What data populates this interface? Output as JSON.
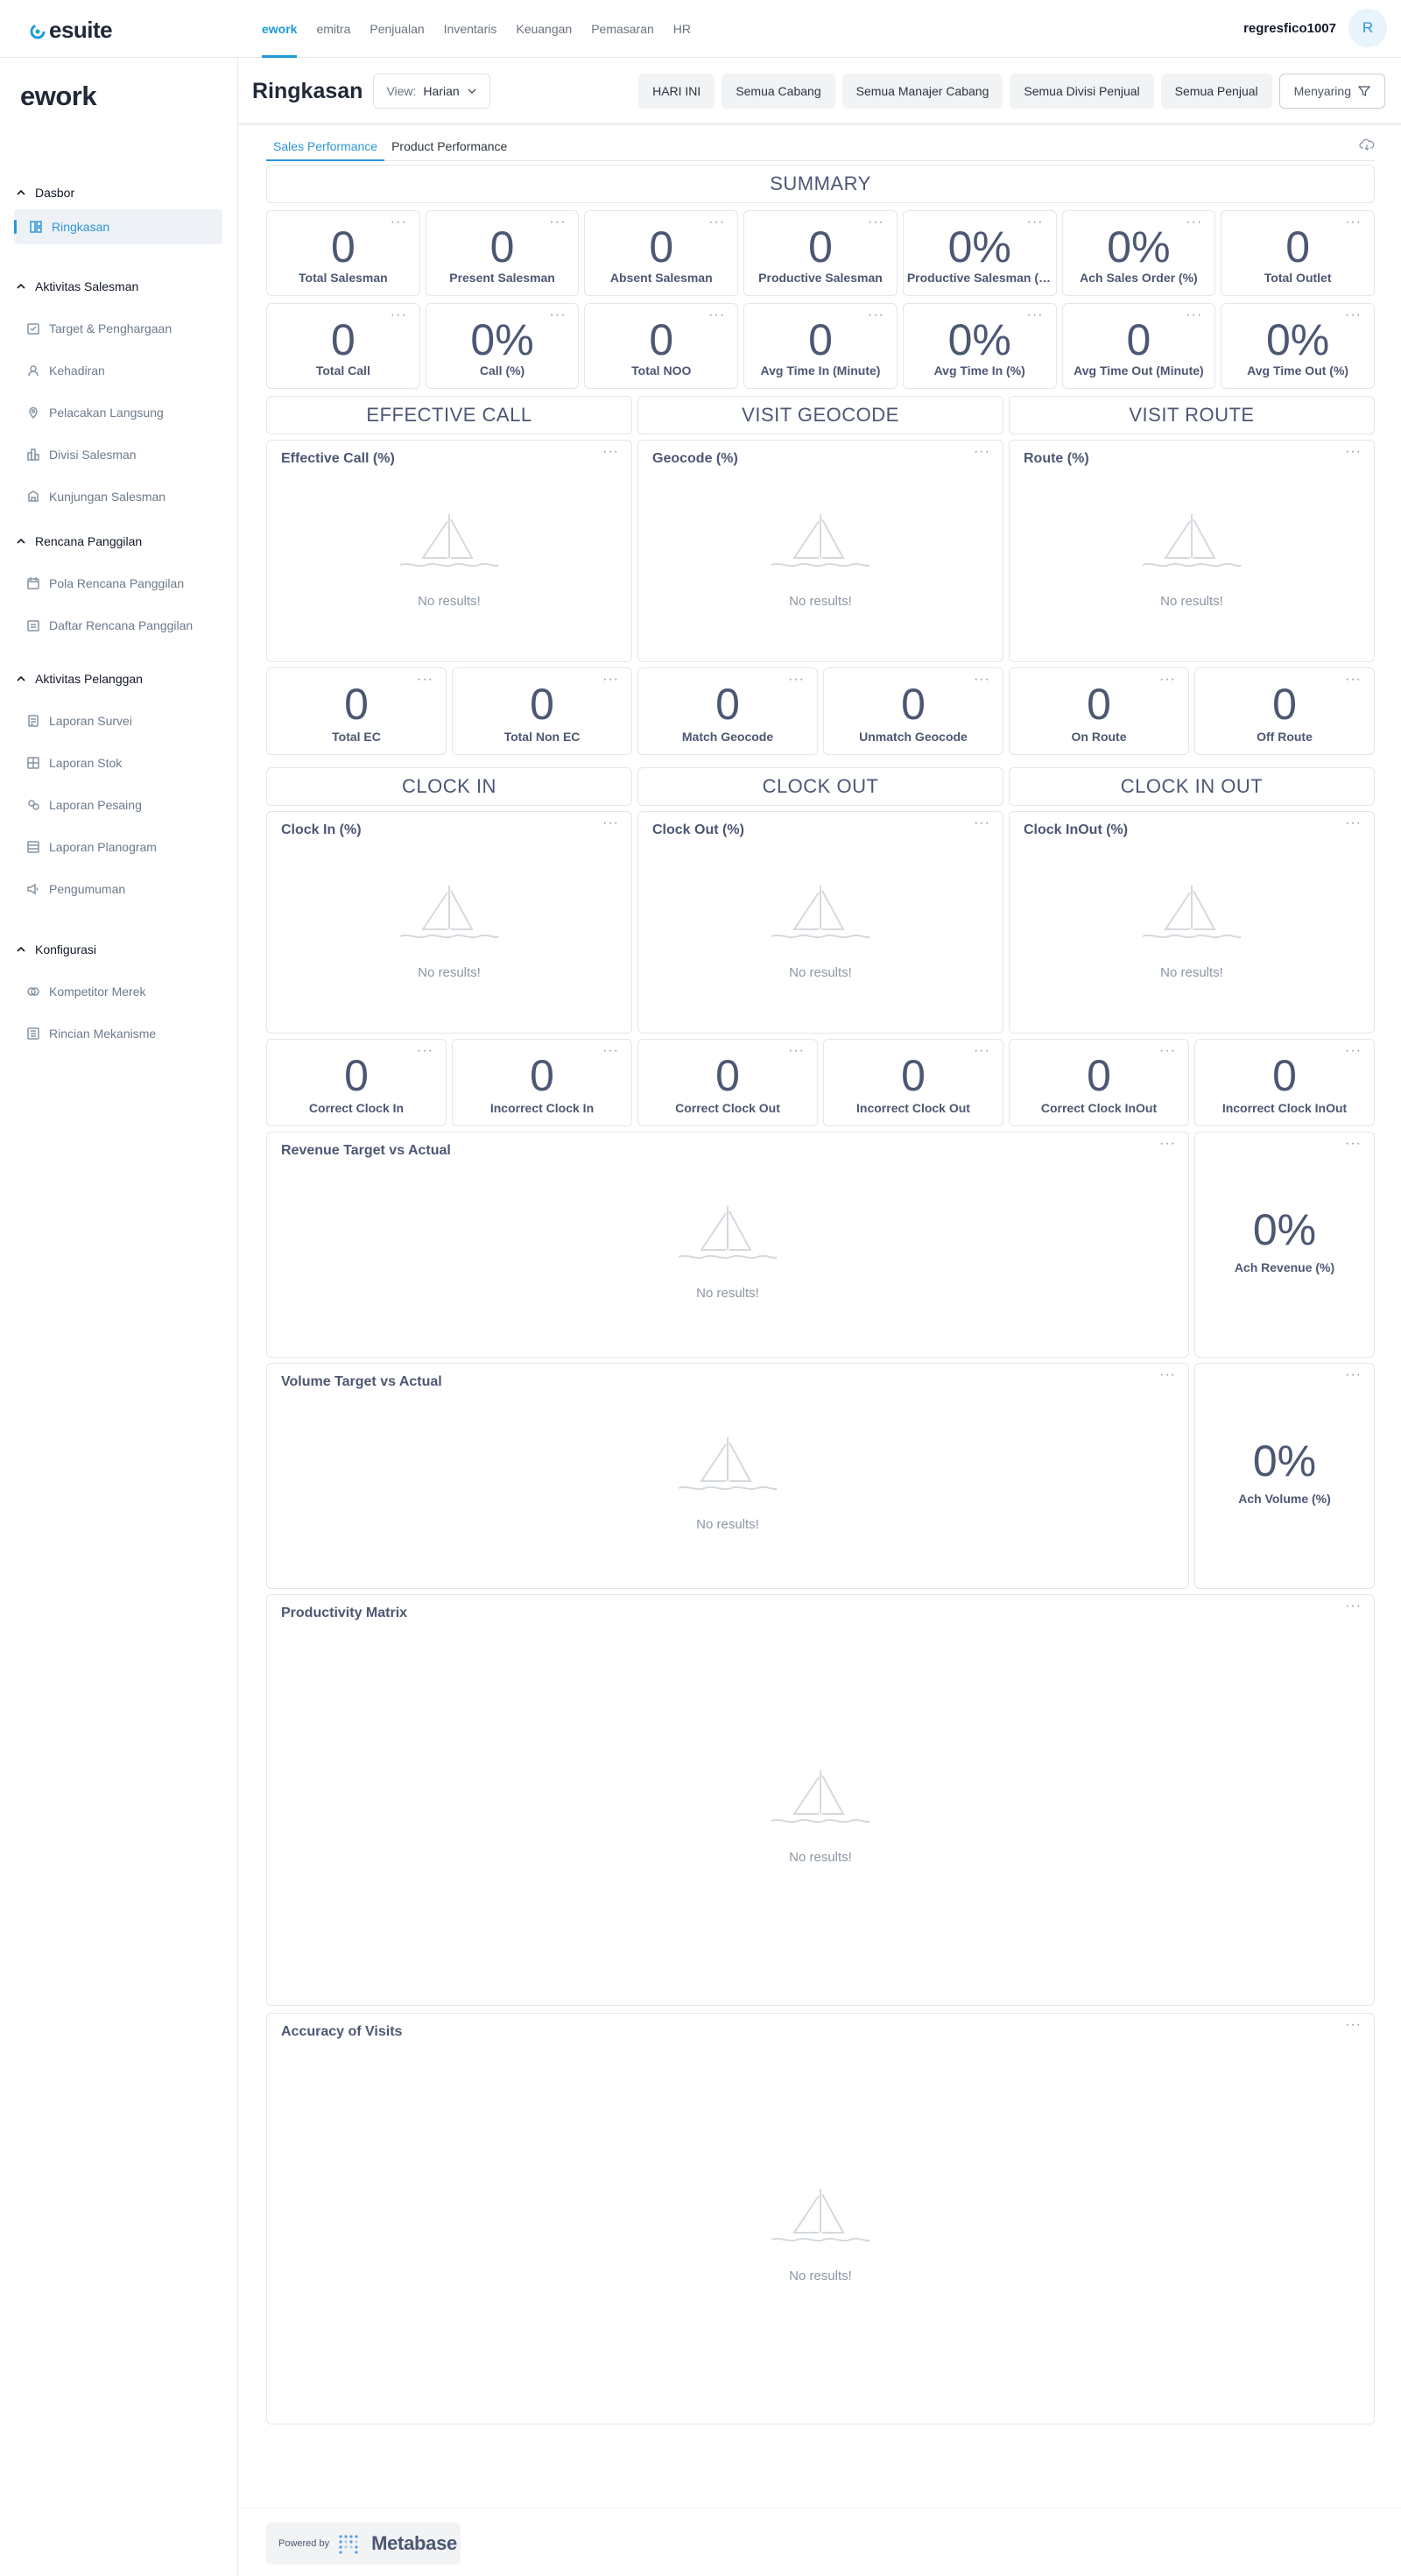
{
  "app": {
    "brand": "esuite"
  },
  "topnav": {
    "items": [
      "ework",
      "emitra",
      "Penjualan",
      "Inventaris",
      "Keuangan",
      "Pemasaran",
      "HR"
    ],
    "active": "ework"
  },
  "user": {
    "name": "regresfico1007",
    "initial": "R"
  },
  "sidebar": {
    "title": "ework",
    "sections": [
      {
        "label": "Dasbor",
        "items": [
          "Ringkasan"
        ]
      },
      {
        "label": "Aktivitas Salesman",
        "items": [
          "Target & Penghargaan",
          "Kehadiran",
          "Pelacakan Langsung",
          "Divisi Salesman",
          "Kunjungan Salesman"
        ]
      },
      {
        "label": "Rencana Panggilan",
        "items": [
          "Pola Rencana Panggilan",
          "Daftar Rencana Panggilan"
        ]
      },
      {
        "label": "Aktivitas Pelanggan",
        "items": [
          "Laporan Survei",
          "Laporan Stok",
          "Laporan Pesaing",
          "Laporan Planogram",
          "Pengumuman"
        ]
      },
      {
        "label": "Konfigurasi",
        "items": [
          "Kompetitor Merek",
          "Rincian Mekanisme"
        ]
      }
    ],
    "active_item": "Ringkasan"
  },
  "header": {
    "title": "Ringkasan",
    "view_label": "View:",
    "view_value": "Harian",
    "filters": [
      "HARI INI",
      "Semua Cabang",
      "Semua Manajer Cabang",
      "Semua Divisi Penjual",
      "Semua Penjual"
    ],
    "filter_button": "Menyaring"
  },
  "tabs": [
    "Sales Performance",
    "Product Performance"
  ],
  "dashboard": {
    "summary_heading": "SUMMARY",
    "summary_row1": [
      {
        "value": "0",
        "label": "Total Salesman"
      },
      {
        "value": "0",
        "label": "Present Salesman"
      },
      {
        "value": "0",
        "label": "Absent Salesman"
      },
      {
        "value": "0",
        "label": "Productive Salesman"
      },
      {
        "value": "0%",
        "label": "Productive Salesman (%)"
      },
      {
        "value": "0%",
        "label": "Ach Sales Order (%)"
      },
      {
        "value": "0",
        "label": "Total Outlet"
      }
    ],
    "summary_row2": [
      {
        "value": "0",
        "label": "Total Call"
      },
      {
        "value": "0%",
        "label": "Call (%)"
      },
      {
        "value": "0",
        "label": "Total NOO"
      },
      {
        "value": "0",
        "label": "Avg Time In (Minute)"
      },
      {
        "value": "0%",
        "label": "Avg Time In (%)"
      },
      {
        "value": "0",
        "label": "Avg Time Out (Minute)"
      },
      {
        "value": "0%",
        "label": "Avg Time Out (%)"
      }
    ],
    "section_headings_1": [
      "EFFECTIVE CALL",
      "VISIT GEOCODE",
      "VISIT ROUTE"
    ],
    "charts_1": [
      "Effective Call (%)",
      "Geocode (%)",
      "Route (%)"
    ],
    "stats_1": [
      {
        "value": "0",
        "label": "Total EC"
      },
      {
        "value": "0",
        "label": "Total Non EC"
      },
      {
        "value": "0",
        "label": "Match Geocode"
      },
      {
        "value": "0",
        "label": "Unmatch Geocode"
      },
      {
        "value": "0",
        "label": "On Route"
      },
      {
        "value": "0",
        "label": "Off Route"
      }
    ],
    "section_headings_2": [
      "CLOCK IN",
      "CLOCK OUT",
      "CLOCK IN OUT"
    ],
    "charts_2": [
      "Clock In (%)",
      "Clock Out (%)",
      "Clock InOut (%)"
    ],
    "stats_2": [
      {
        "value": "0",
        "label": "Correct Clock In"
      },
      {
        "value": "0",
        "label": "Incorrect Clock In"
      },
      {
        "value": "0",
        "label": "Correct Clock Out"
      },
      {
        "value": "0",
        "label": "Incorrect Clock Out"
      },
      {
        "value": "0",
        "label": "Correct Clock InOut"
      },
      {
        "value": "0",
        "label": "Incorrect Clock InOut"
      }
    ],
    "revenue_chart": "Revenue Target vs Actual",
    "ach_revenue": {
      "value": "0%",
      "label": "Ach Revenue (%)"
    },
    "volume_chart": "Volume Target vs Actual",
    "ach_volume": {
      "value": "0%",
      "label": "Ach Volume (%)"
    },
    "productivity_chart": "Productivity Matrix",
    "accuracy_chart": "Accuracy of Visits",
    "no_results": "No results!",
    "more_icon": "···"
  },
  "footer": {
    "powered_by": "Powered by",
    "product": "Metabase"
  },
  "colors": {
    "accent": "#2b96d6",
    "text_muted": "#4c5773"
  }
}
